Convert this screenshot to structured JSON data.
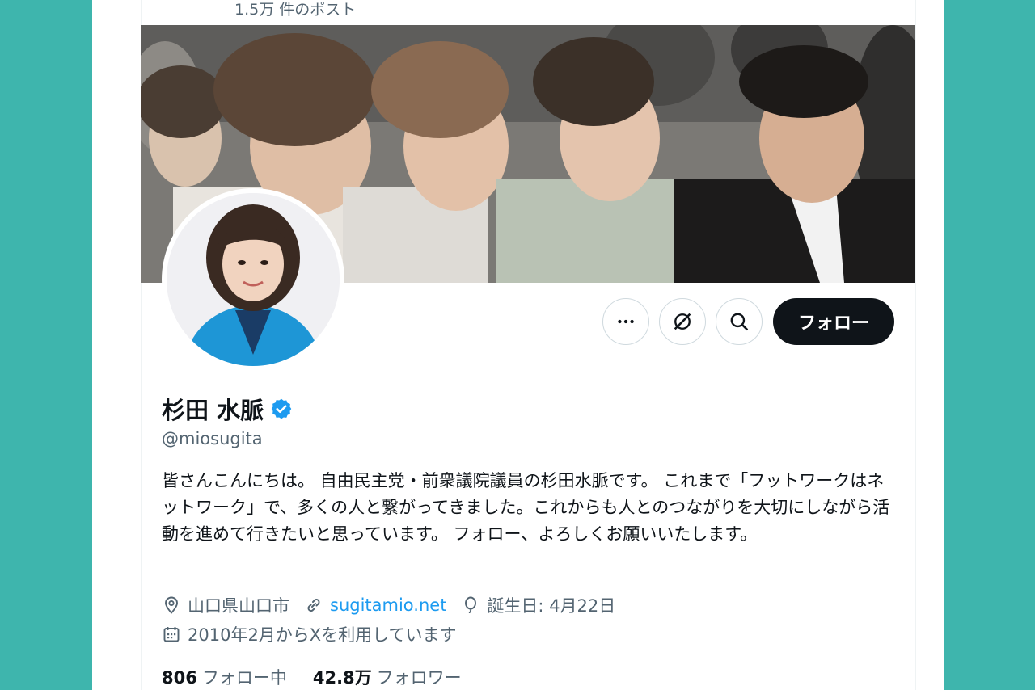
{
  "header": {
    "post_count": "1.5万 件のポスト"
  },
  "actions": {
    "more": "more-icon",
    "grok": "grok-icon",
    "search": "search-icon",
    "follow_label": "フォロー"
  },
  "profile": {
    "display_name": "杉田 水脈",
    "verified": true,
    "handle": "@miosugita",
    "bio": "皆さんこんにちは。 自由民主党・前衆議院議員の杉田水脈です。 これまで「フットワークはネットワーク」で、多くの人と繋がってきました。これからも人とのつながりを大切にしながら活動を進めて行きたいと思っています。 フォロー、よろしくお願いいたします。",
    "location": "山口県山口市",
    "website": "sugitamio.net",
    "birthday": "誕生日: 4月22日",
    "joined": "2010年2月からXを利用しています"
  },
  "stats": {
    "following_count": "806",
    "following_label": "フォロー中",
    "followers_count": "42.8万",
    "followers_label": "フォロワー"
  },
  "colors": {
    "background": "#3eb5ad",
    "follow_button": "#0f1419",
    "link": "#1d9bf0",
    "verified_badge": "#1d9bf0",
    "secondary_text": "#536471"
  }
}
